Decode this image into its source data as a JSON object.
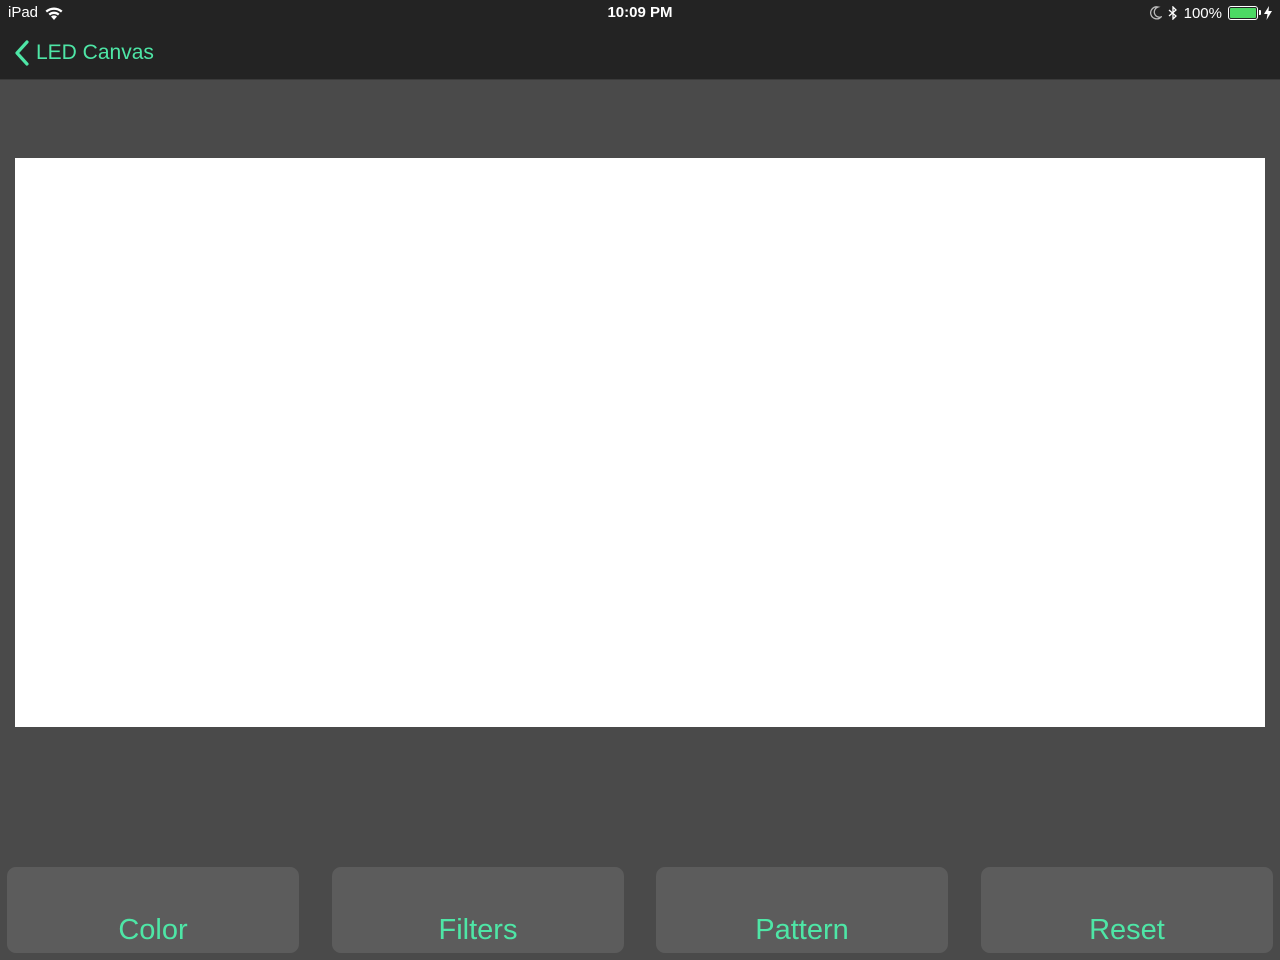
{
  "status_bar": {
    "carrier": "iPad",
    "time": "10:09 PM",
    "battery_percent": "100%",
    "battery_level": 1.0,
    "icons": [
      "wifi-icon",
      "moon-icon",
      "bluetooth-icon",
      "battery-icon",
      "charging-bolt-icon"
    ]
  },
  "nav": {
    "back_label": "LED Canvas",
    "back_icon": "chevron-left-icon"
  },
  "toolbar": {
    "color_label": "Color",
    "filters_label": "Filters",
    "pattern_label": "Pattern",
    "reset_label": "Reset"
  },
  "colors": {
    "accent": "#4ee6a6",
    "background": "#4a4a4a",
    "nav_background": "#232323",
    "button_background": "#5c5c5c",
    "canvas": "#ffffff",
    "battery": "#4cd964"
  }
}
